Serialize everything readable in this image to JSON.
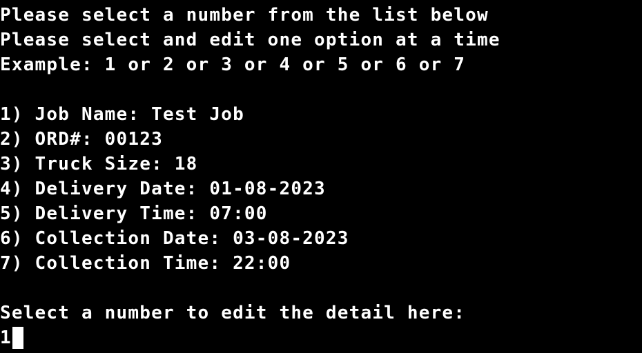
{
  "prompts": {
    "line1": "Please select a number from the list below",
    "line2": "Please select and edit one option at a time",
    "line3": "Example: 1 or 2 or 3 or 4 or 5 or 6 or 7"
  },
  "options": [
    "1) Job Name: Test Job",
    "2) ORD#: 00123",
    "3) Truck Size: 18",
    "4) Delivery Date: 01-08-2023",
    "5) Delivery Time: 07:00",
    "6) Collection Date: 03-08-2023",
    "7) Collection Time: 22:00"
  ],
  "input": {
    "prompt": "Select a number to edit the detail here:",
    "value": "1"
  },
  "colors": {
    "background": "#000000",
    "foreground": "#ffffff"
  }
}
